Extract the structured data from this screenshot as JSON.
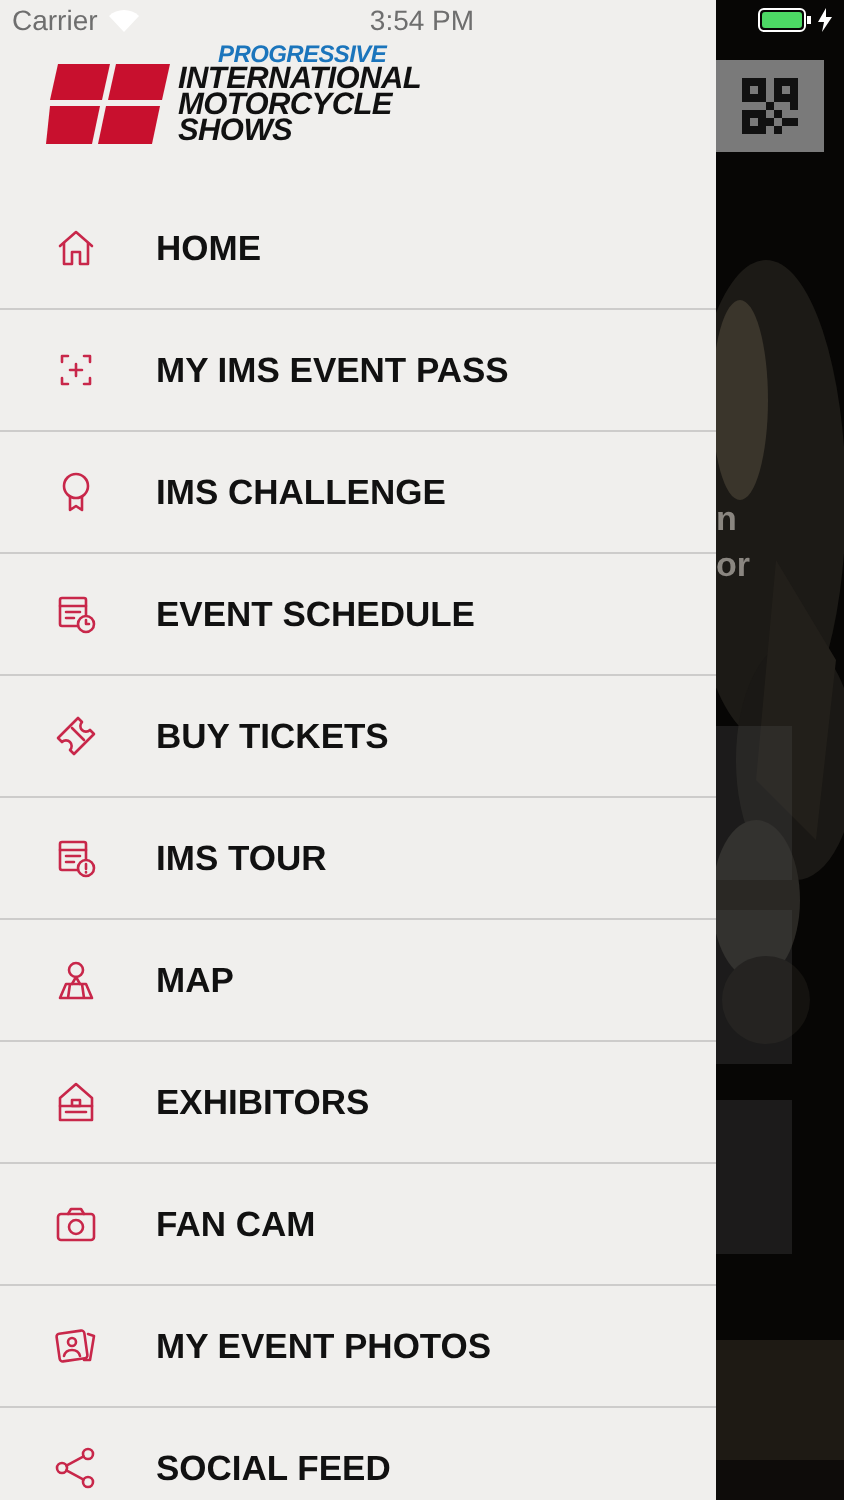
{
  "status_bar": {
    "carrier": "Carrier",
    "time": "3:54 PM"
  },
  "logo": {
    "sponsor": "PROGRESSIVE",
    "lines": [
      "INTERNATIONAL",
      "MOTORCYCLE",
      "SHOWS"
    ]
  },
  "menu": {
    "items": [
      {
        "label": "HOME"
      },
      {
        "label": "MY IMS EVENT PASS"
      },
      {
        "label": "IMS CHALLENGE"
      },
      {
        "label": "EVENT SCHEDULE"
      },
      {
        "label": "BUY TICKETS"
      },
      {
        "label": "IMS TOUR"
      },
      {
        "label": "MAP"
      },
      {
        "label": "EXHIBITORS"
      },
      {
        "label": "FAN CAM"
      },
      {
        "label": "MY EVENT PHOTOS"
      },
      {
        "label": "SOCIAL FEED"
      }
    ]
  },
  "background": {
    "kind": "picture",
    "texts": [
      "n",
      "or"
    ]
  }
}
